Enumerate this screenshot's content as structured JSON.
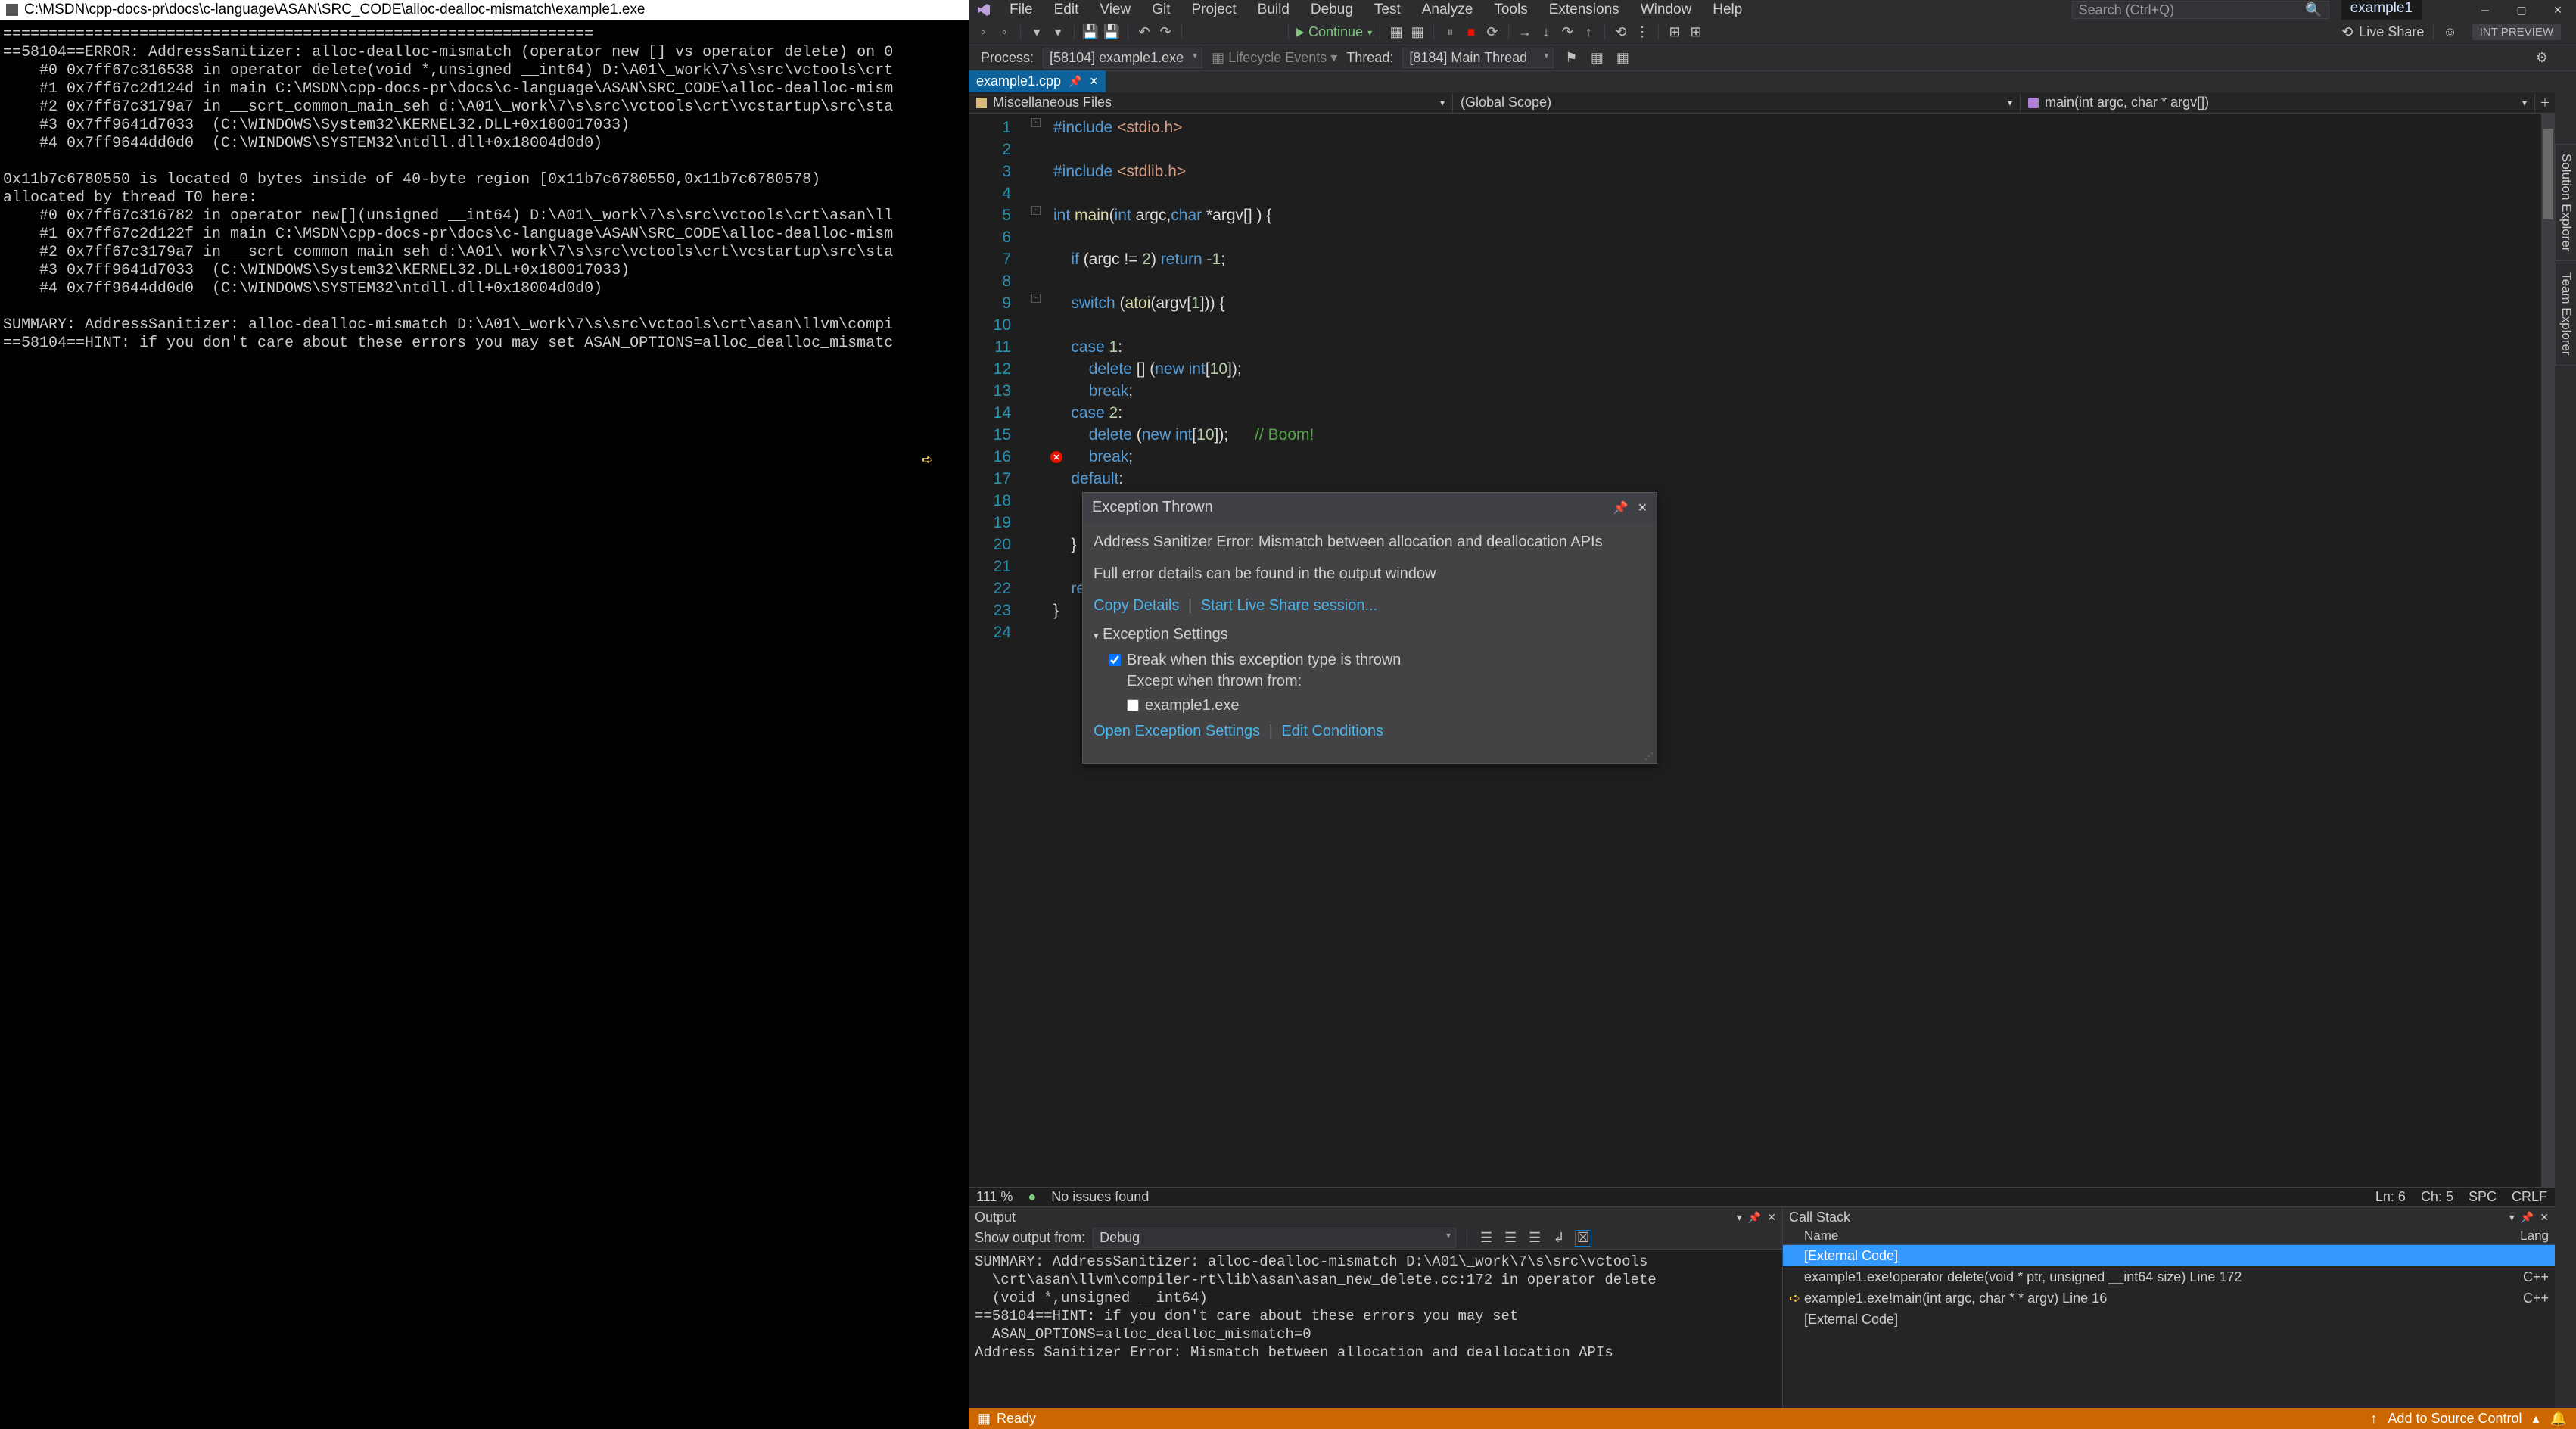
{
  "console": {
    "title": "C:\\MSDN\\cpp-docs-pr\\docs\\c-language\\ASAN\\SRC_CODE\\alloc-dealloc-mismatch\\example1.exe",
    "text": "=================================================================\n==58104==ERROR: AddressSanitizer: alloc-dealloc-mismatch (operator new [] vs operator delete) on 0\n    #0 0x7ff67c316538 in operator delete(void *,unsigned __int64) D:\\A01\\_work\\7\\s\\src\\vctools\\crt\n    #1 0x7ff67c2d124d in main C:\\MSDN\\cpp-docs-pr\\docs\\c-language\\ASAN\\SRC_CODE\\alloc-dealloc-mism\n    #2 0x7ff67c3179a7 in __scrt_common_main_seh d:\\A01\\_work\\7\\s\\src\\vctools\\crt\\vcstartup\\src\\sta\n    #3 0x7ff9641d7033  (C:\\WINDOWS\\System32\\KERNEL32.DLL+0x180017033)\n    #4 0x7ff9644dd0d0  (C:\\WINDOWS\\SYSTEM32\\ntdll.dll+0x18004d0d0)\n\n0x11b7c6780550 is located 0 bytes inside of 40-byte region [0x11b7c6780550,0x11b7c6780578)\nallocated by thread T0 here:\n    #0 0x7ff67c316782 in operator new[](unsigned __int64) D:\\A01\\_work\\7\\s\\src\\vctools\\crt\\asan\\ll\n    #1 0x7ff67c2d122f in main C:\\MSDN\\cpp-docs-pr\\docs\\c-language\\ASAN\\SRC_CODE\\alloc-dealloc-mism\n    #2 0x7ff67c3179a7 in __scrt_common_main_seh d:\\A01\\_work\\7\\s\\src\\vctools\\crt\\vcstartup\\src\\sta\n    #3 0x7ff9641d7033  (C:\\WINDOWS\\System32\\KERNEL32.DLL+0x180017033)\n    #4 0x7ff9644dd0d0  (C:\\WINDOWS\\SYSTEM32\\ntdll.dll+0x18004d0d0)\n\nSUMMARY: AddressSanitizer: alloc-dealloc-mismatch D:\\A01\\_work\\7\\s\\src\\vctools\\crt\\asan\\llvm\\compi\n==58104==HINT: if you don't care about these errors you may set ASAN_OPTIONS=alloc_dealloc_mismatc"
  },
  "vs": {
    "menu": [
      "File",
      "Edit",
      "View",
      "Git",
      "Project",
      "Build",
      "Debug",
      "Test",
      "Analyze",
      "Tools",
      "Extensions",
      "Window",
      "Help"
    ],
    "search_placeholder": "Search (Ctrl+Q)",
    "solution_tab": "example1",
    "int_preview": "INT PREVIEW",
    "continue": "Continue",
    "liveshare": "Live Share",
    "process_label": "Process:",
    "process_value": "[58104] example1.exe",
    "lifecycle": "Lifecycle Events",
    "thread_label": "Thread:",
    "thread_value": "[8184] Main Thread",
    "side_tabs": [
      "Solution Explorer",
      "Team Explorer"
    ],
    "doc_tab": "example1.cpp",
    "nav": {
      "left": "Miscellaneous Files",
      "mid": "(Global Scope)",
      "right": "main(int argc, char * argv[])"
    },
    "lines": [
      "1",
      "2",
      "3",
      "4",
      "5",
      "6",
      "7",
      "8",
      "9",
      "10",
      "11",
      "12",
      "13",
      "14",
      "15",
      "16",
      "17",
      "18",
      "19",
      "20",
      "21",
      "22",
      "23",
      "24"
    ],
    "zoom": "111 %",
    "issues": "No issues found",
    "pos": {
      "ln": "Ln: 6",
      "col": "Ch: 5",
      "spc": "SPC",
      "crlf": "CRLF"
    }
  },
  "exception": {
    "title": "Exception Thrown",
    "body1": "Address Sanitizer Error: Mismatch between allocation and deallocation APIs",
    "body2": "Full error details can be found in the output window",
    "copy": "Copy Details",
    "live": "Start Live Share session...",
    "settings_label": "Exception Settings",
    "break_label": "Break when this exception type is thrown",
    "except_label": "Except when thrown from:",
    "module": "example1.exe",
    "open": "Open Exception Settings",
    "edit": "Edit Conditions"
  },
  "output": {
    "title": "Output",
    "from_label": "Show output from:",
    "from_value": "Debug",
    "text": "SUMMARY: AddressSanitizer: alloc-dealloc-mismatch D:\\A01\\_work\\7\\s\\src\\vctools\n  \\crt\\asan\\llvm\\compiler-rt\\lib\\asan\\asan_new_delete.cc:172 in operator delete\n  (void *,unsigned __int64)\n==58104==HINT: if you don't care about these errors you may set\n  ASAN_OPTIONS=alloc_dealloc_mismatch=0\nAddress Sanitizer Error: Mismatch between allocation and deallocation APIs"
  },
  "callstack": {
    "title": "Call Stack",
    "name_col": "Name",
    "lang_col": "Lang",
    "rows": [
      {
        "name": "[External Code]",
        "lang": "",
        "sel": true
      },
      {
        "name": "example1.exe!operator delete(void * ptr, unsigned __int64 size) Line 172",
        "lang": "C++"
      },
      {
        "name": "example1.exe!main(int argc, char * * argv) Line 16",
        "lang": "C++",
        "arrow": true
      },
      {
        "name": "[External Code]",
        "lang": ""
      }
    ]
  },
  "status": {
    "ready": "Ready",
    "source": "Add to Source Control"
  }
}
